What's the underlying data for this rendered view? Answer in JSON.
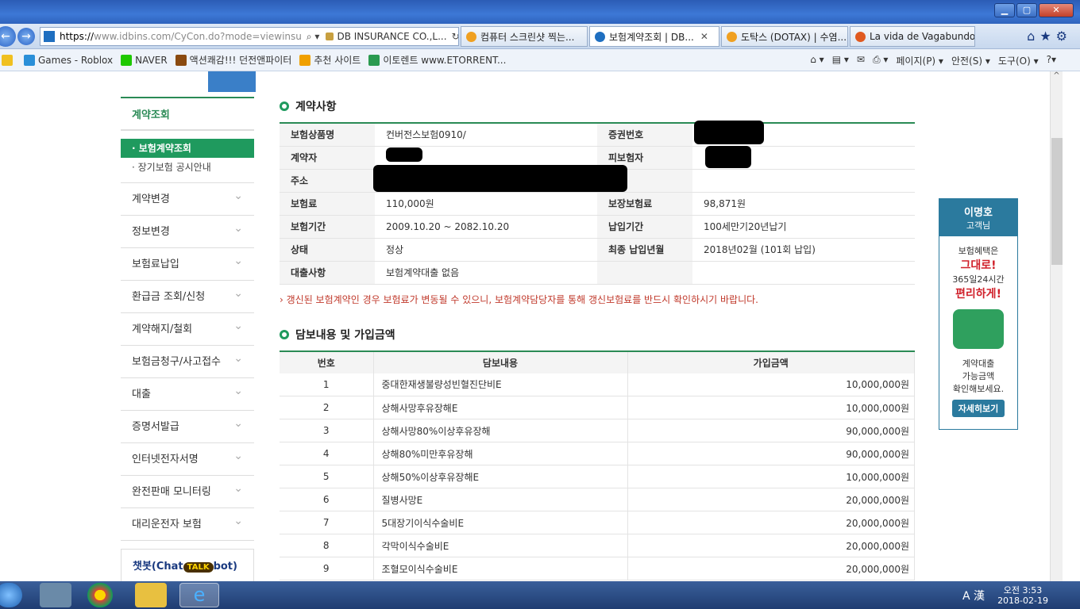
{
  "browser": {
    "url_https": "https://",
    "url_rest": "www.idbins.com/CyCon.do?mode=viewinsu",
    "site_id": "DB INSURANCE CO.,L...",
    "tabs": [
      {
        "label": "컴퓨터 스크린샷 찍는...",
        "color": "#f0a020"
      },
      {
        "label": "보험계약조회 | DB...",
        "color": "#1f6fc0"
      },
      {
        "label": "도탁스 (DOTAX) | 수염...",
        "color": "#f0a020"
      },
      {
        "label": "La vida de Vagabundo ...",
        "color": "#e05a20"
      }
    ],
    "favorites": [
      "Games - Roblox",
      "NAVER",
      "액션쾌감!!! 던전앤파이터",
      "추천 사이트",
      "이토렌트 www.ETORRENT..."
    ],
    "commands": [
      "페이지(P) ▾",
      "안전(S) ▾",
      "도구(O) ▾"
    ]
  },
  "sidebar": {
    "title": "계약조회",
    "active": "· 보험계약조회",
    "sub": "· 장기보험 공시안내",
    "items": [
      "계약변경",
      "정보변경",
      "보험료납입",
      "환급금 조회/신청",
      "계약해지/철회",
      "보험금청구/사고접수",
      "대출",
      "증명서발급",
      "인터넷전자서명",
      "완전판매 모니터링",
      "대리운전자 보험"
    ],
    "chatbot_a": "챗봇",
    "chatbot_b": "(Chat",
    "chatbot_talk": "TALK",
    "chatbot_c": "bot)"
  },
  "contract": {
    "section_title": "계약사항",
    "rows": [
      {
        "h1": "보험상품명",
        "v1": "컨버전스보험0910/",
        "h2": "증권번호",
        "v2": ""
      },
      {
        "h1": "계약자",
        "v1": "",
        "h2": "피보험자",
        "v2": ""
      },
      {
        "h1": "주소",
        "v1": "",
        "h2": "",
        "v2": ""
      },
      {
        "h1": "보험료",
        "v1": "110,000원",
        "h2": "보장보험료",
        "v2": "98,871원"
      },
      {
        "h1": "보험기간",
        "v1": "2009.10.20 ~ 2082.10.20",
        "h2": "납입기간",
        "v2": "100세만기20년납기"
      },
      {
        "h1": "상태",
        "v1": "정상",
        "h2": "최종 납입년월",
        "v2": "2018년02월 (101회 납입)"
      },
      {
        "h1": "대출사항",
        "v1": "보험계약대출 없음",
        "h2": "",
        "v2": ""
      }
    ],
    "notice": "› 갱신된 보험계약인 경우 보험료가 변동될 수 있으니, 보험계약담당자를 통해 갱신보험료를 반드시 확인하시기 바랍니다."
  },
  "coverage": {
    "section_title": "담보내용 및 가입금액",
    "headers": [
      "번호",
      "담보내용",
      "가입금액"
    ],
    "rows": [
      {
        "no": "1",
        "desc": "중대한재생불량성빈혈진단비E",
        "amt": "10,000,000원"
      },
      {
        "no": "2",
        "desc": "상해사망후유장해E",
        "amt": "10,000,000원"
      },
      {
        "no": "3",
        "desc": "상해사망80%이상후유장해",
        "amt": "90,000,000원"
      },
      {
        "no": "4",
        "desc": "상해80%미만후유장해",
        "amt": "90,000,000원"
      },
      {
        "no": "5",
        "desc": "상해50%이상후유장해E",
        "amt": "10,000,000원"
      },
      {
        "no": "6",
        "desc": "질병사망E",
        "amt": "20,000,000원"
      },
      {
        "no": "7",
        "desc": "5대장기이식수술비E",
        "amt": "20,000,000원"
      },
      {
        "no": "8",
        "desc": "각막이식수술비E",
        "amt": "20,000,000원"
      },
      {
        "no": "9",
        "desc": "조혈모이식수술비E",
        "amt": "20,000,000원"
      }
    ]
  },
  "ad": {
    "name": "이명호",
    "suffix": "고객님",
    "line1": "보험혜택은",
    "red1": "그대로!",
    "line2": "365일24시간",
    "red2": "편리하게!",
    "line3": "계약대출",
    "line4": "가능금액",
    "line5": "확인해보세요.",
    "button": "자세히보기"
  },
  "taskbar": {
    "time": "오전 3:53",
    "date": "2018-02-19",
    "ime": "A 漢"
  }
}
